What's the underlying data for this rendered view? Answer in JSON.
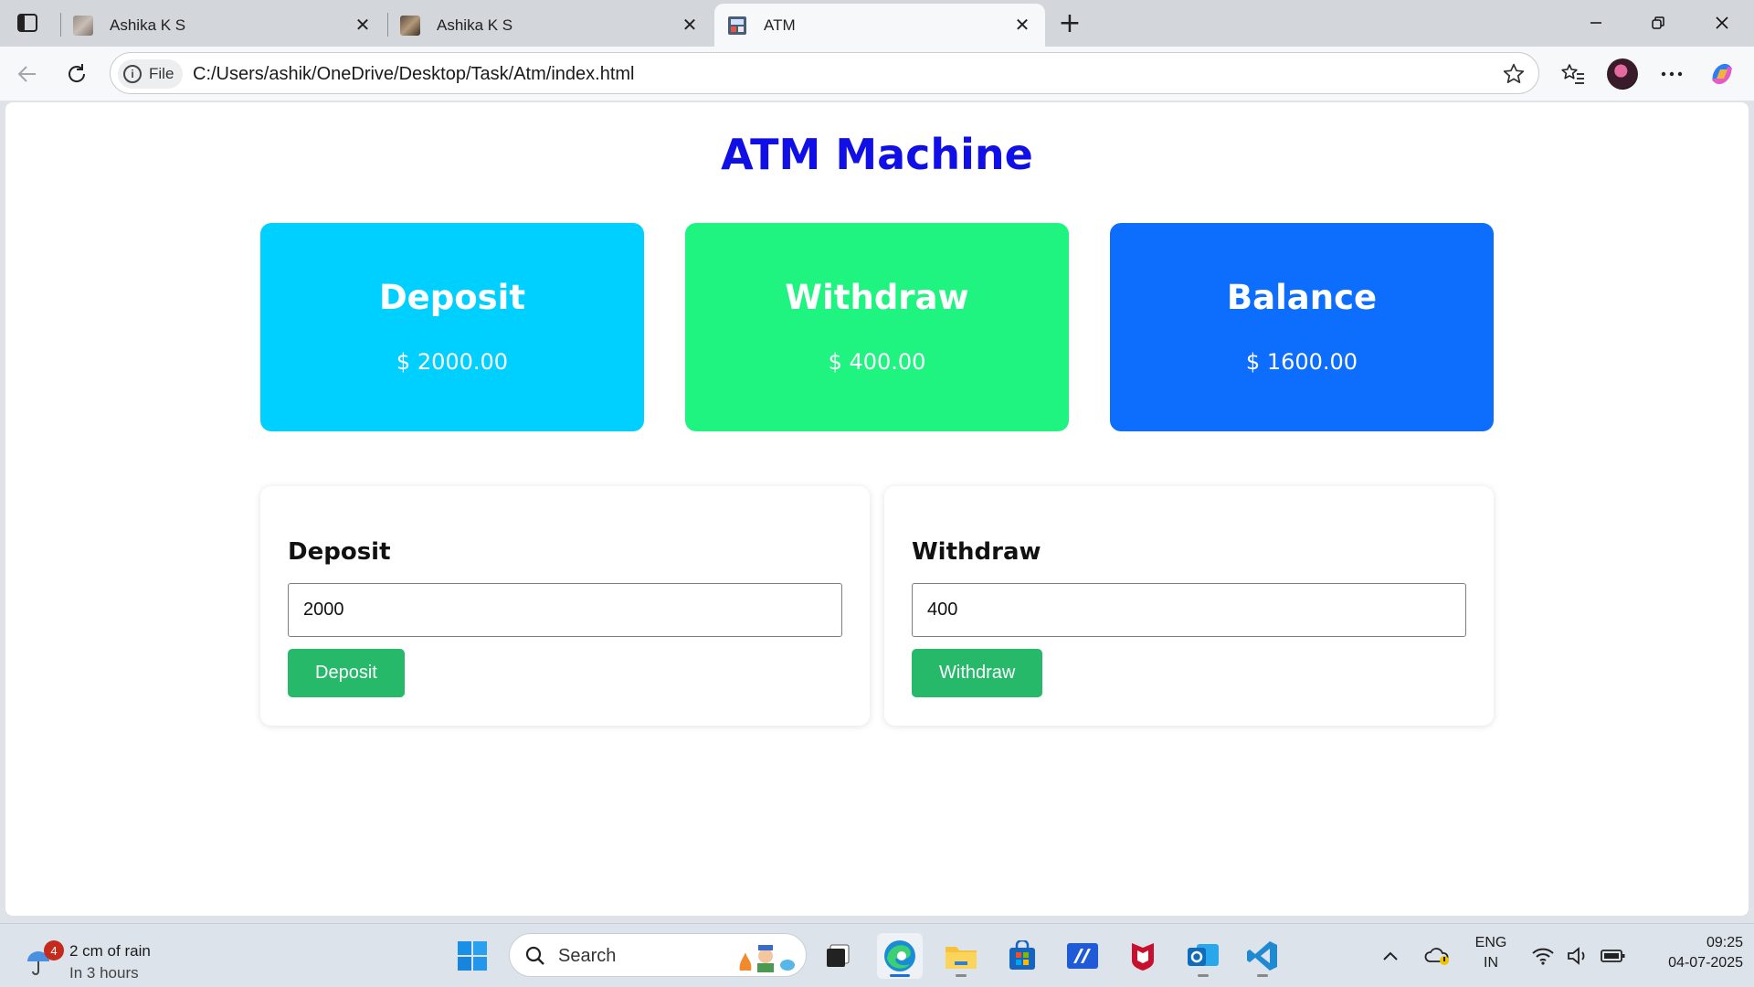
{
  "browser": {
    "tabs": [
      {
        "title": "Ashika K S",
        "active": false
      },
      {
        "title": "Ashika K S",
        "active": false
      },
      {
        "title": "ATM",
        "active": true
      }
    ],
    "site_chip_label": "File",
    "url": "C:/Users/ashik/OneDrive/Desktop/Task/Atm/index.html"
  },
  "page": {
    "title": "ATM Machine",
    "cards": [
      {
        "label": "Deposit",
        "amount": "$ 2000.00",
        "color": "#00d0ff"
      },
      {
        "label": "Withdraw",
        "amount": "$ 400.00",
        "color": "#1ef47f"
      },
      {
        "label": "Balance",
        "amount": "$ 1600.00",
        "color": "#0d6efd"
      }
    ],
    "deposit_panel": {
      "heading": "Deposit",
      "input_value": "2000",
      "button_label": "Deposit"
    },
    "withdraw_panel": {
      "heading": "Withdraw",
      "input_value": "400",
      "button_label": "Withdraw"
    },
    "accent_button_color": "#27b96a"
  },
  "taskbar": {
    "weather": {
      "badge": "4",
      "line1": "2 cm of rain",
      "line2": "In 3 hours"
    },
    "search_label": "Search",
    "apps": [
      "task-view-icon",
      "edge-icon",
      "file-explorer-icon",
      "microsoft-store-icon",
      "mcafee-web-icon",
      "mcafee-icon",
      "outlook-icon",
      "vscode-icon"
    ],
    "language": {
      "line1": "ENG",
      "line2": "IN"
    },
    "clock": {
      "time": "09:25",
      "date": "04-07-2025"
    }
  }
}
